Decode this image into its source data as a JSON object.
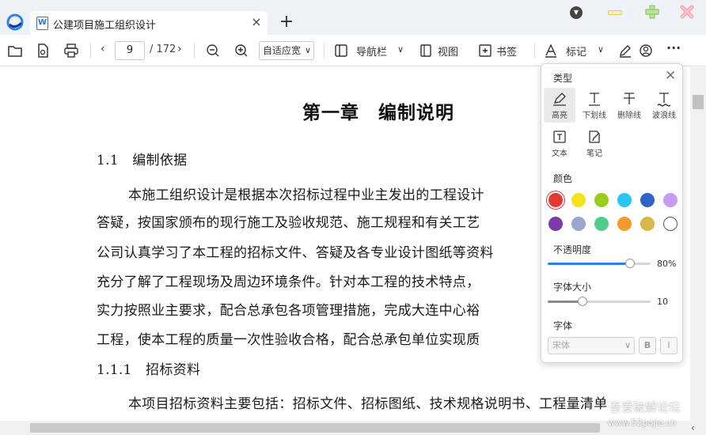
{
  "tab": {
    "title": "公建项目施工组织设计",
    "doc_icon": "W",
    "close": "×"
  },
  "new_tab": "+",
  "toolbar": {
    "page_current": "9",
    "page_total": "/ 172",
    "zoom": "自适应宽",
    "nav_label": "导航栏",
    "view_label": "视图",
    "bookmark_label": "书签",
    "mark_label": "标记",
    "more": "···"
  },
  "document": {
    "chapter_title": "第一章　编制说明",
    "lines": [
      "1.1　编制依据",
      "本施工组织设计是根据本次招标过程中业主发出的工程设计",
      "答疑，按国家颁布的现行施工及验收规范、施工规程和有关工艺",
      "公司认真学习了本工程的招标文件、答疑及各专业设计图纸等资料",
      "充分了解了工程现场及周边环境条件。针对本工程的技术特点，",
      "实力按照业主要求，配合总承包各项管理措施，完成大连中心裕",
      "工程，使本工程的质量一次性验收合格，配合总承包单位实现质",
      "1.1.1　招标资料",
      "本项目招标资料主要包括：招标文件、招标图纸、技术规格说明书、工程量清单"
    ]
  },
  "panel": {
    "type_label": "类型",
    "tools": [
      {
        "label": "高亮",
        "icon": "highlight-icon",
        "active": true
      },
      {
        "label": "下划线",
        "icon": "underline-icon",
        "active": false
      },
      {
        "label": "删除线",
        "icon": "strikethrough-icon",
        "active": false
      },
      {
        "label": "波浪线",
        "icon": "wavy-line-icon",
        "active": false
      },
      {
        "label": "文本",
        "icon": "text-box-icon",
        "active": false
      },
      {
        "label": "笔记",
        "icon": "note-icon",
        "active": false
      }
    ],
    "color_label": "颜色",
    "colors": [
      "#e53935",
      "#f5e21b",
      "#9ccc1c",
      "#29c5f6",
      "#2f63c9",
      "#c79bf2",
      "#7b3aa8",
      "#99a6d1",
      "#4fce8a",
      "#f59a2e",
      "#d8b64a",
      "#ffffff"
    ],
    "selected_color": "#e53935",
    "opacity_label": "不透明度",
    "opacity_value": "80%",
    "opacity_fraction": 0.8,
    "fontsize_label": "字体大小",
    "fontsize_value": "10",
    "fontsize_fraction": 0.34,
    "font_label": "字体",
    "font_value": "宋体",
    "bold_label": "B",
    "italic_label": "I",
    "accent": "#2f7ff0"
  },
  "watermark": {
    "line1": "吾爱破解论坛",
    "line2": "www.52pojie.cn"
  }
}
